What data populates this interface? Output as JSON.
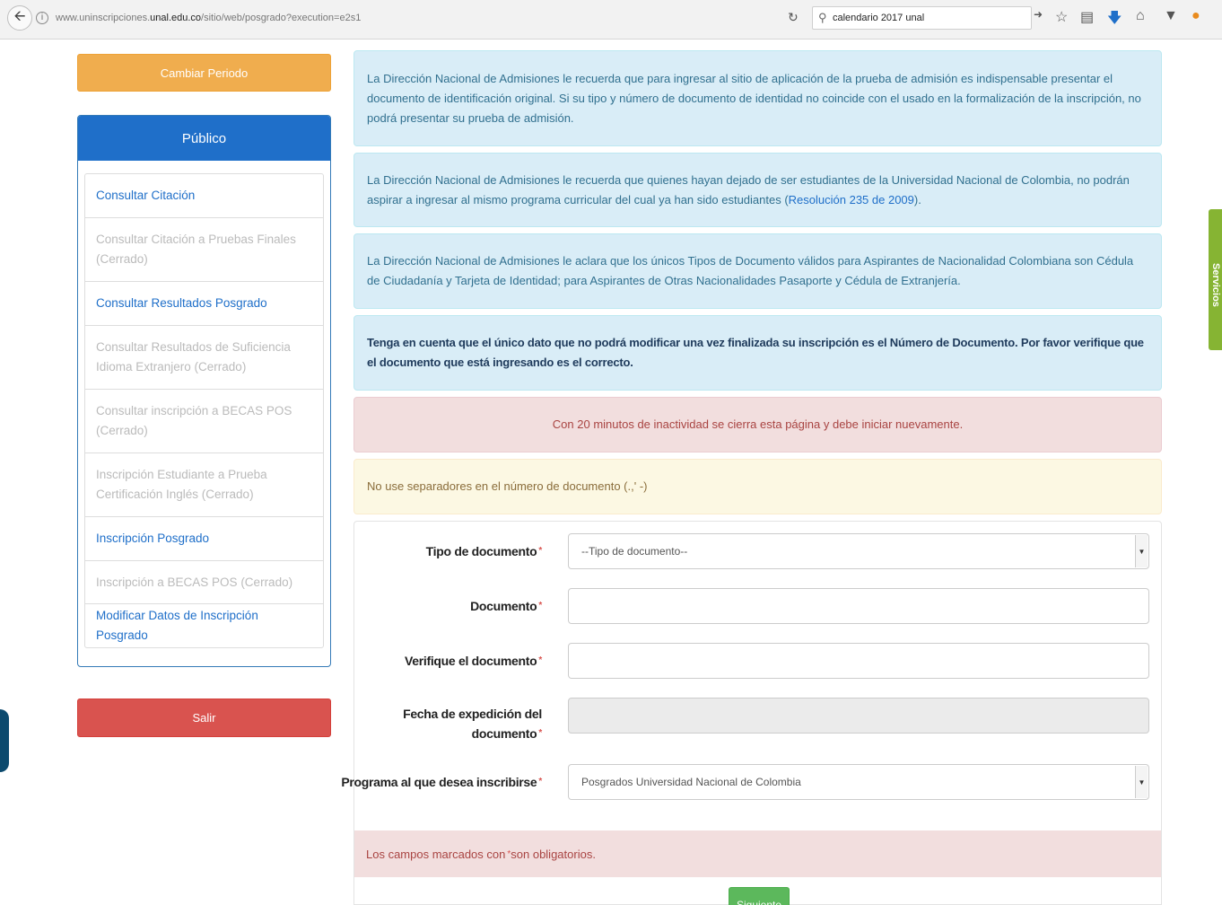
{
  "browser": {
    "url_prefix": "www.uninscripciones.",
    "url_domain": "unal.edu.co",
    "url_path": "/sitio/web/posgrado?execution=e2s1",
    "search_value": "calendario 2017 unal"
  },
  "sidebar": {
    "periodo_button": "Cambiar Periodo",
    "panel_title": "Público",
    "items": [
      {
        "label": "Consultar Citación",
        "state": "active"
      },
      {
        "label": "Consultar Citación a Pruebas Finales (Cerrado)",
        "state": "disabled"
      },
      {
        "label": "Consultar Resultados Posgrado",
        "state": "active"
      },
      {
        "label": "Consultar Resultados de Suficiencia Idioma Extranjero (Cerrado)",
        "state": "disabled"
      },
      {
        "label": "Consultar inscripción a BECAS POS (Cerrado)",
        "state": "disabled"
      },
      {
        "label": "Inscripción Estudiante a Prueba Certificación Inglés (Cerrado)",
        "state": "disabled"
      },
      {
        "label": "Inscripción Posgrado",
        "state": "active"
      },
      {
        "label": "Inscripción a BECAS POS (Cerrado)",
        "state": "disabled"
      },
      {
        "label": "Modificar Datos de Inscripción Posgrado",
        "state": "active"
      }
    ],
    "exit_button": "Salir"
  },
  "alerts": {
    "info1": "La Dirección Nacional de Admisiones le recuerda que para ingresar al sitio de aplicación de la prueba de admisión es indispensable presentar el documento de identificación original. Si su tipo y número de documento de identidad no coincide con el usado en la formalización de la inscripción, no podrá presentar su prueba de admisión.",
    "info2_text": "La Dirección Nacional de Admisiones le recuerda que quienes hayan dejado de ser estudiantes de la Universidad Nacional de Colombia, no podrán aspirar a ingresar al mismo programa curricular del cual ya han sido estudiantes (",
    "info2_link": "Resolución 235 de 2009",
    "info2_end": ").",
    "info3": "La Dirección Nacional de Admisiones le aclara que los únicos Tipos de Documento válidos para Aspirantes de Nacionalidad Colombiana son Cédula de Ciudadanía y Tarjeta de Identidad; para Aspirantes de Otras Nacionalidades Pasaporte y Cédula de Extranjería.",
    "info4": "Tenga en cuenta que el único dato que no podrá modificar una vez finalizada su inscripción es el Número de Documento. Por favor verifique que el documento que está ingresando es el correcto.",
    "danger": "Con 20 minutos de inactividad se cierra esta página y debe iniciar nuevamente.",
    "warning": "No use separadores en el número de documento (.,' -)"
  },
  "form": {
    "tipo_label": "Tipo de documento",
    "tipo_value": "--Tipo de documento--",
    "documento_label": "Documento",
    "documento_value": "",
    "verifique_label": "Verifique el documento",
    "verifique_value": "",
    "fecha_label_line1": "Fecha de expedición del",
    "fecha_label_line2": "documento",
    "fecha_value": "",
    "programa_label": "Programa al que desea inscribirse",
    "programa_value": "Posgrados Universidad Nacional de Colombia",
    "required_symbol": "*",
    "required_note_before": "Los campos marcados con ",
    "required_note_after": " son obligatorios.",
    "submit_label": "Siguiente"
  },
  "services_tab_label": "Servicios"
}
